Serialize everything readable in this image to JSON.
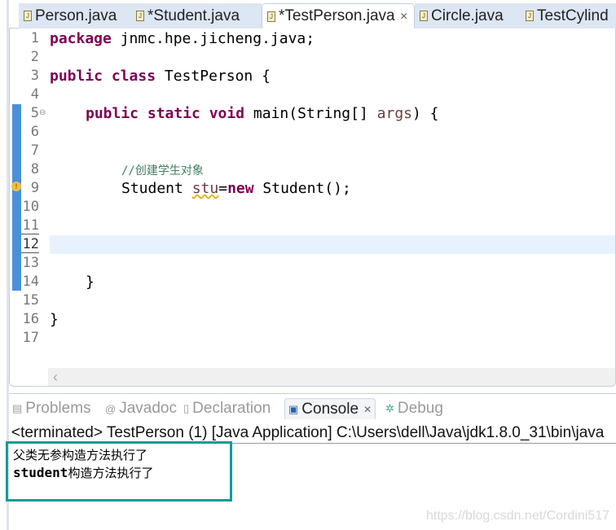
{
  "tabs": [
    {
      "label": "Person.java",
      "active": false
    },
    {
      "label": "*Student.java",
      "active": false
    },
    {
      "label": "*TestPerson.java",
      "active": true
    },
    {
      "label": "Circle.java",
      "active": false
    },
    {
      "label": "TestCylind",
      "active": false
    }
  ],
  "editor": {
    "line_numbers": [
      "1",
      "2",
      "3",
      "4",
      "5",
      "6",
      "7",
      "8",
      "9",
      "10",
      "11",
      "12",
      "13",
      "14",
      "15",
      "16",
      "17"
    ],
    "current_line": 12,
    "code": {
      "l1_kw": "package",
      "l1_rest": " jnmc.hpe.jicheng.java;",
      "l3_kw": "public class",
      "l3_rest": " TestPerson {",
      "l5_kw": "public static void",
      "l5_a": " main(String[] ",
      "l5_var": "args",
      "l5_b": ") {",
      "l8_comment": "//创建学生对象",
      "l9_a": "Student ",
      "l9_var": "stu",
      "l9_b": "=",
      "l9_kw": "new",
      "l9_c": " Student();",
      "l14": "}",
      "l16": "}"
    }
  },
  "console": {
    "tabs": [
      {
        "label": "Problems",
        "icon": "problems-icon"
      },
      {
        "label": "Javadoc",
        "icon": "at-icon"
      },
      {
        "label": "Declaration",
        "icon": "declaration-icon"
      },
      {
        "label": "Console",
        "icon": "console-icon",
        "active": true
      },
      {
        "label": "Debug",
        "icon": "bug-icon"
      }
    ],
    "status": "<terminated> TestPerson (1) [Java Application] C:\\Users\\dell\\Java\\jdk1.8.0_31\\bin\\java",
    "output": {
      "line1": "父类无参构造方法执行了",
      "line2_a": "student",
      "line2_b": "构造方法执行了"
    },
    "highlight_color": "#169a96"
  },
  "watermark": "https://blog.csdn.net/Cordini517"
}
